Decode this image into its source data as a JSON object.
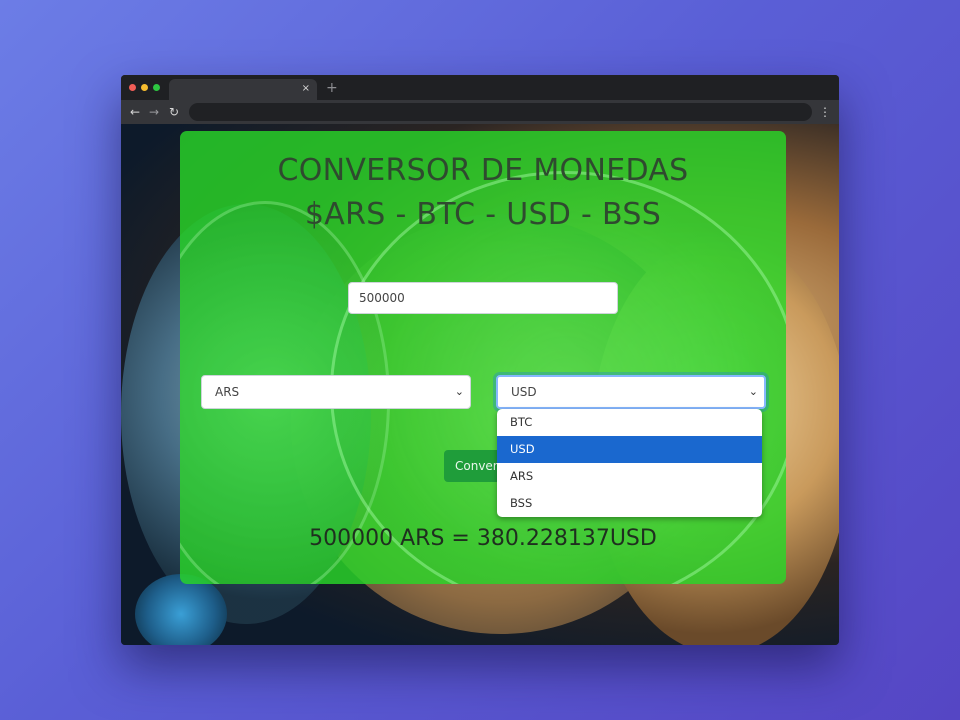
{
  "browser": {
    "tab_close": "×",
    "new_tab": "+",
    "back": "←",
    "forward": "→",
    "reload": "↻",
    "menu": "⋮",
    "address": ""
  },
  "page": {
    "title_line1": "CONVERSOR DE MONEDAS",
    "title_line2": "$ARS - BTC - USD - BSS",
    "amount_value": "500000",
    "from_currency": "ARS",
    "to_currency": "USD",
    "convert_label": "Convertir",
    "dropdown_options": [
      "BTC",
      "USD",
      "ARS",
      "BSS"
    ],
    "selected_option": "USD",
    "result_text": "500000 ARS = 380.228137USD"
  },
  "colors": {
    "panel_green": "#28d728",
    "button_green": "#1f9d3a",
    "selected_blue": "#1a68cf"
  }
}
